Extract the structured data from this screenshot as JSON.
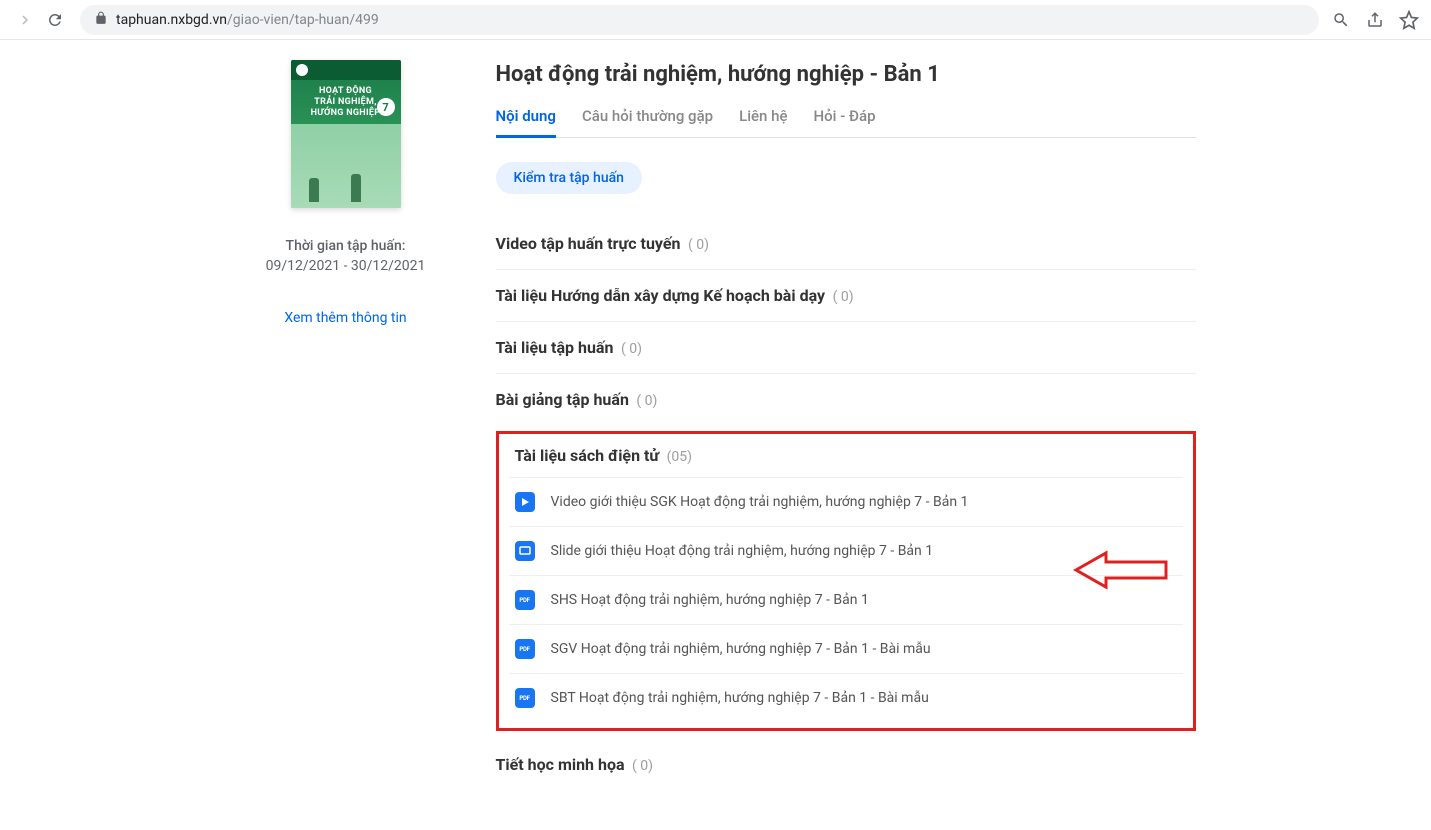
{
  "browser": {
    "url_host": "taphuan.nxbgd.vn",
    "url_path": "/giao-vien/tap-huan/499"
  },
  "sidebar": {
    "cover_title_line1": "HOẠT ĐỘNG",
    "cover_title_line2": "TRẢI NGHIỆM,",
    "cover_title_line3": "HƯỚNG NGHIỆP",
    "cover_number": "7",
    "training_label": "Thời gian tập huấn:",
    "training_dates": "09/12/2021 - 30/12/2021",
    "more_info": "Xem thêm thông tin"
  },
  "main": {
    "title": "Hoạt động trải nghiệm, hướng nghiệp - Bản 1",
    "tabs": [
      {
        "label": "Nội dung",
        "active": true
      },
      {
        "label": "Câu hỏi thường gặp",
        "active": false
      },
      {
        "label": "Liên hệ",
        "active": false
      },
      {
        "label": "Hỏi - Đáp",
        "active": false
      }
    ],
    "chip": "Kiểm tra tập huấn",
    "sections": [
      {
        "title": "Video tập huấn trực tuyến",
        "count": "( 0)"
      },
      {
        "title": "Tài liệu Hướng dẫn xây dựng Kế hoạch bài dạy",
        "count": "( 0)"
      },
      {
        "title": "Tài liệu tập huấn",
        "count": "( 0)"
      },
      {
        "title": "Bài giảng tập huấn",
        "count": "( 0)"
      }
    ],
    "ebook_section": {
      "title": "Tài liệu sách điện tử",
      "count": "(05)",
      "items": [
        {
          "icon": "video",
          "label": "Video giới thiệu SGK Hoạt động trải nghiệm, hướng nghiệp 7 - Bản 1"
        },
        {
          "icon": "slide",
          "label": "Slide giới thiệu Hoạt động trải nghiệm, hướng nghiệp 7 - Bản 1"
        },
        {
          "icon": "pdf",
          "label": "SHS Hoạt động trải nghiệm, hướng nghiệp 7 - Bản 1"
        },
        {
          "icon": "pdf",
          "label": "SGV Hoạt động trải nghiệm, hướng nghiệp 7 - Bản 1 - Bài mẫu"
        },
        {
          "icon": "pdf",
          "label": "SBT Hoạt động trải nghiệm, hướng nghiệp 7 - Bản 1 - Bài mẫu"
        }
      ]
    },
    "lesson_section": {
      "title": "Tiết học minh họa",
      "count": "( 0)"
    }
  }
}
